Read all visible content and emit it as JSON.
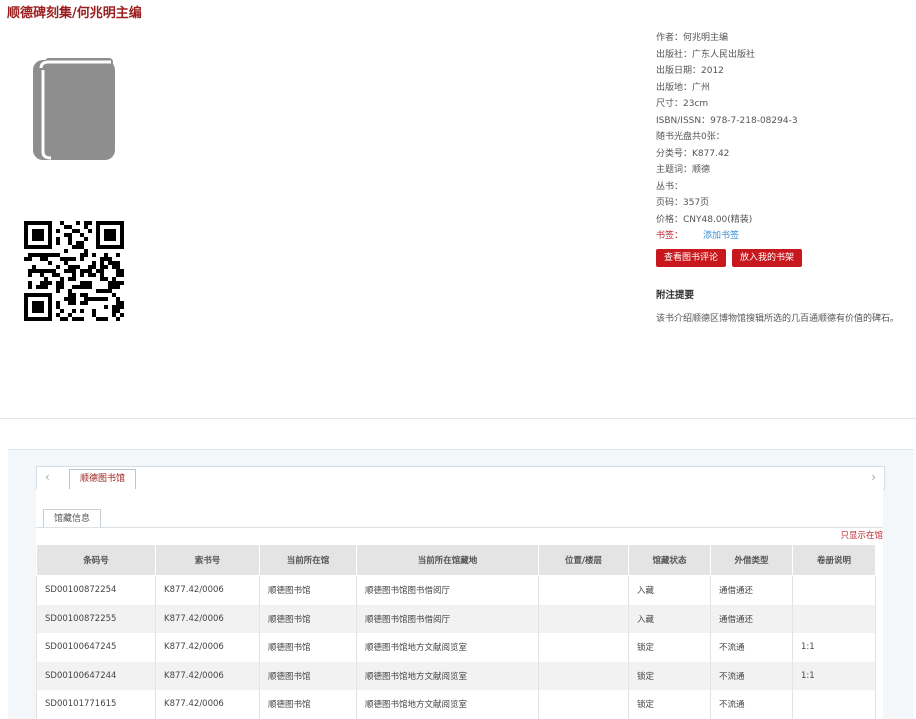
{
  "title": "顺德碑刻集/何兆明主编",
  "icons": {
    "book": "book-icon",
    "qr": "qr-code-icon",
    "left": "chevron-left-icon",
    "right": "chevron-right-icon"
  },
  "info": {
    "rows": [
      "作者：何兆明主编",
      "出版社：广东人民出版社",
      "出版日期：2012",
      "出版地：广州",
      "尺寸：23cm",
      "ISBN/ISSN：978-7-218-08294-3",
      "随书光盘共0张：",
      "分类号：K877.42",
      "主题词：顺德",
      "丛书：",
      "页码：357页",
      "价格：CNY48.00(精装)"
    ],
    "tags_label": "书签：",
    "tags_link": "添加书签",
    "btn_review": "查看图书评论",
    "btn_shelf": "放入我的书架",
    "abstract_title": "附注提要",
    "abstract": "该书介绍顺德区博物馆搜辑所选的几百通顺德有价值的碑石。"
  },
  "library_tab": "顺德图书馆",
  "sub_tab": "馆藏信息",
  "only_show": "只显示在馆",
  "table": {
    "headers": [
      "条码号",
      "索书号",
      "当前所在馆",
      "当前所在馆藏地",
      "位置/楼层",
      "馆藏状态",
      "外借类型",
      "卷册说明"
    ],
    "rows": [
      [
        "SD00100872254",
        "K877.42/0006",
        "顺德图书馆",
        "顺德图书馆图书借阅厅",
        "",
        "入藏",
        "通借通还",
        ""
      ],
      [
        "SD00100872255",
        "K877.42/0006",
        "顺德图书馆",
        "顺德图书馆图书借阅厅",
        "",
        "入藏",
        "通借通还",
        ""
      ],
      [
        "SD00100647245",
        "K877.42/0006",
        "顺德图书馆",
        "顺德图书馆地方文献阅览室",
        "",
        "锁定",
        "不流通",
        "1:1"
      ],
      [
        "SD00100647244",
        "K877.42/0006",
        "顺德图书馆",
        "顺德图书馆地方文献阅览室",
        "",
        "锁定",
        "不流通",
        "1:1"
      ],
      [
        "SD00101771615",
        "K877.42/0006",
        "顺德图书馆",
        "顺德图书馆地方文献阅览室",
        "",
        "锁定",
        "不流通",
        ""
      ]
    ]
  }
}
